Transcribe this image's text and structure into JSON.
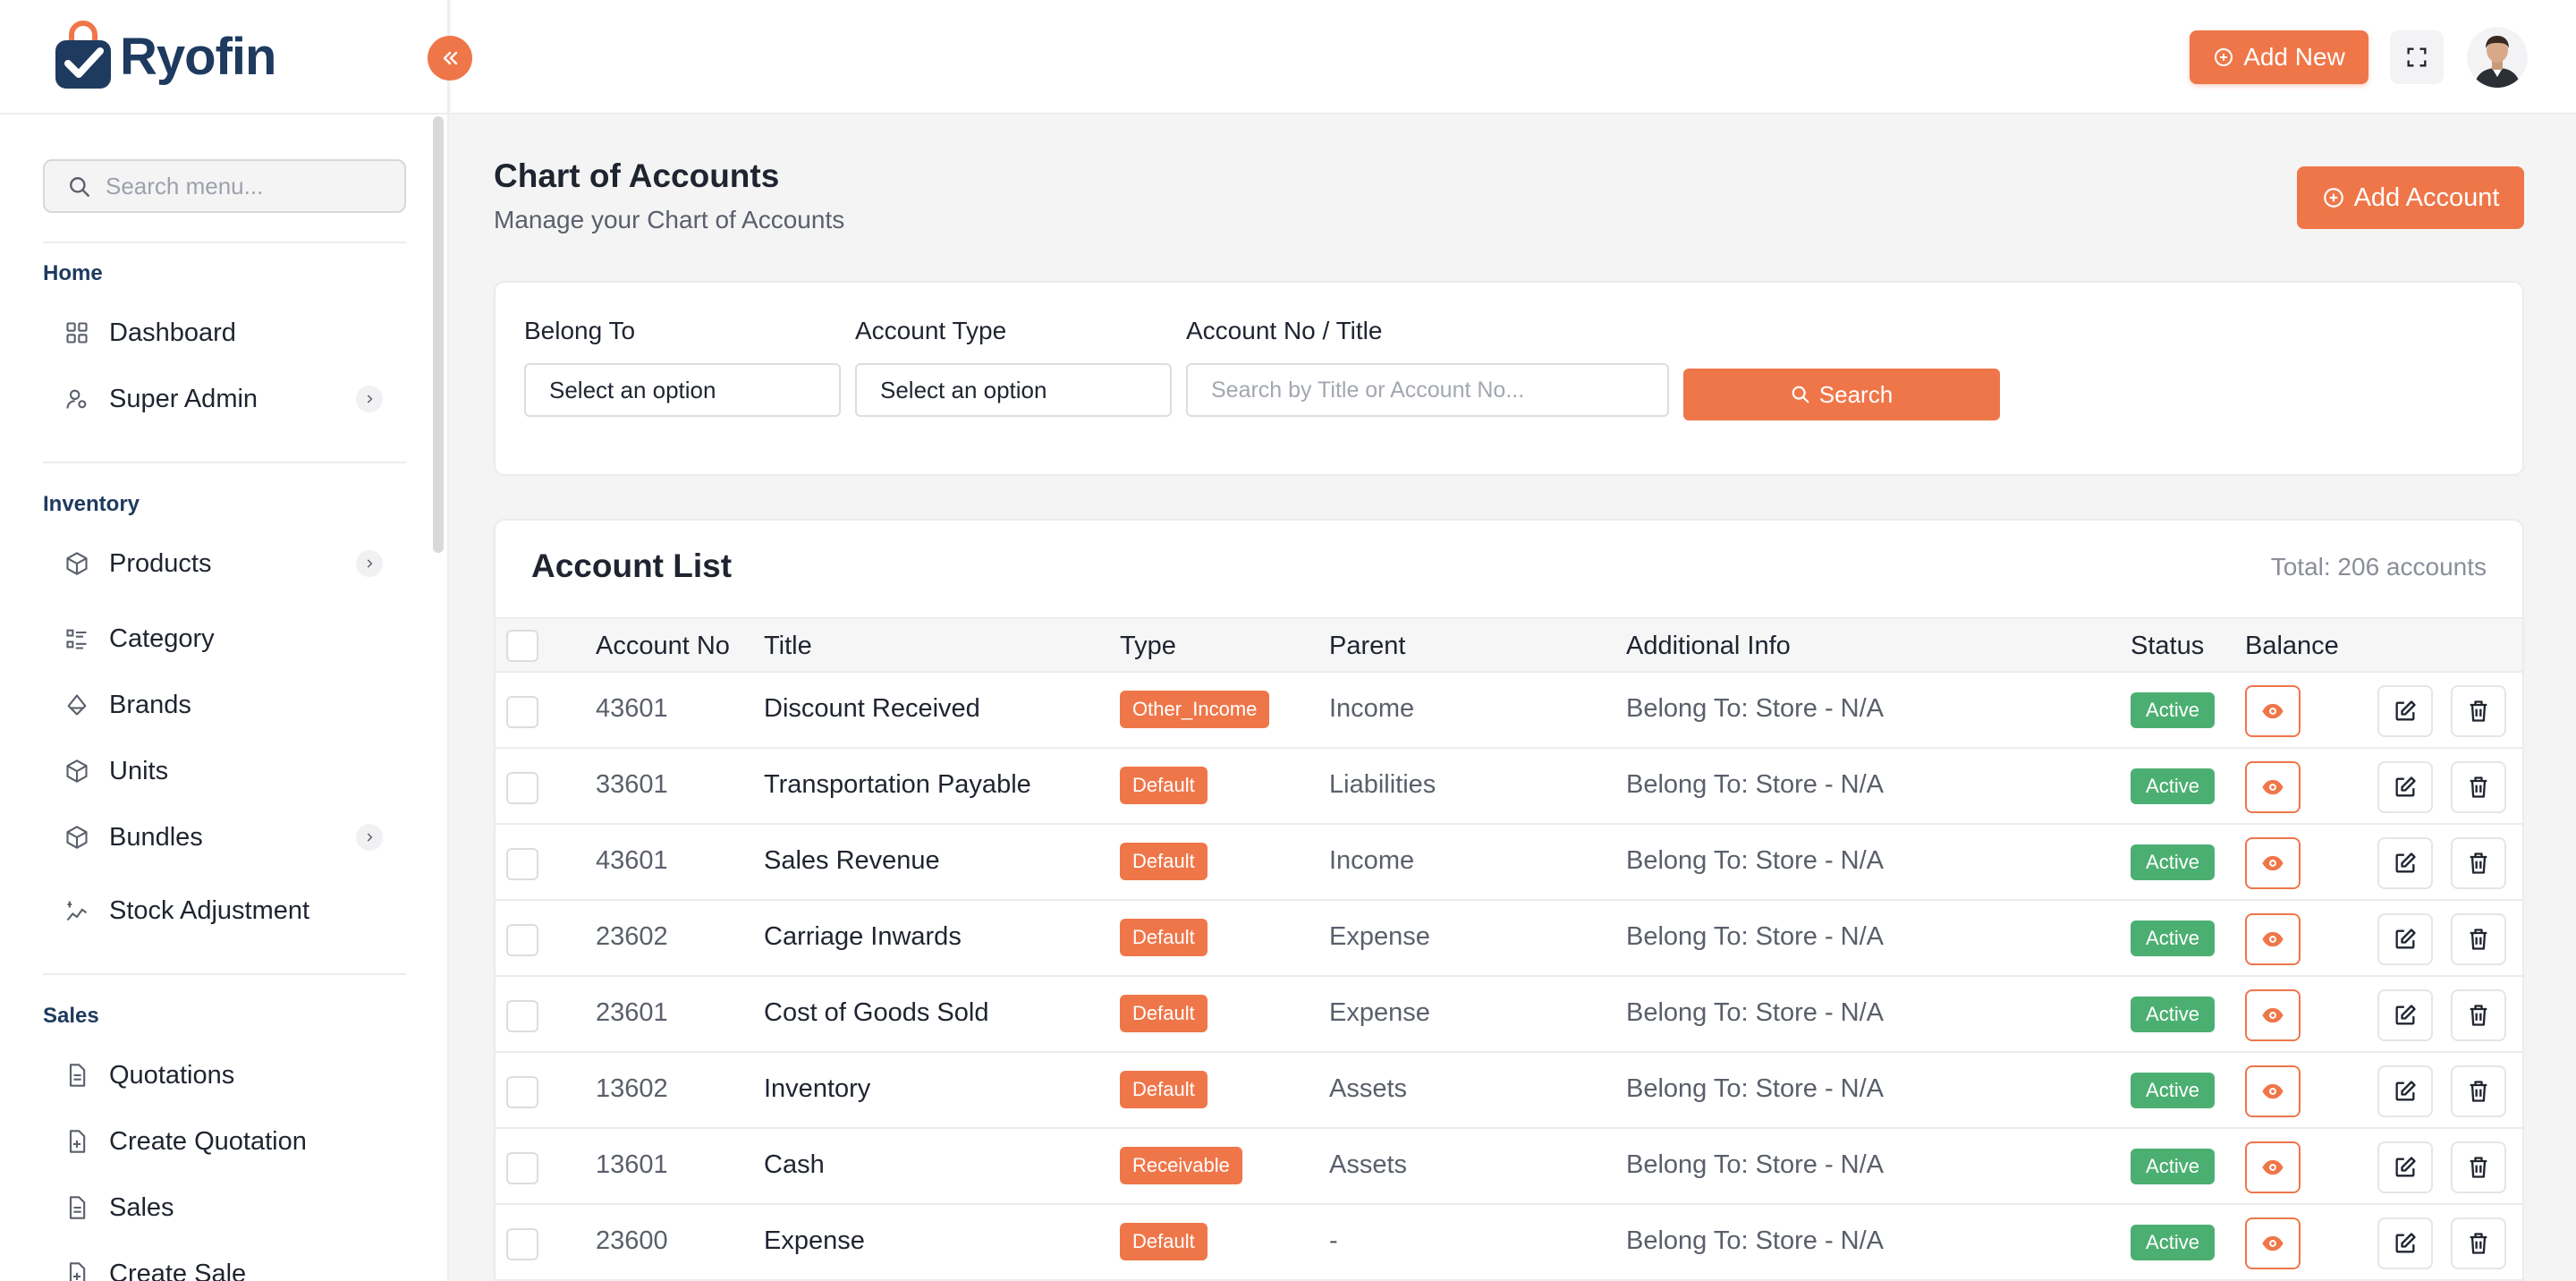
{
  "brand": {
    "name": "Ryofin"
  },
  "sidebar": {
    "search_placeholder": "Search menu...",
    "sections": [
      {
        "title": "Home"
      },
      {
        "title": "Inventory"
      },
      {
        "title": "Sales"
      }
    ],
    "items": [
      {
        "label": "Dashboard",
        "icon": "grid-icon"
      },
      {
        "label": "Super Admin",
        "icon": "user-cog-icon"
      },
      {
        "label": "Products",
        "icon": "box-icon"
      },
      {
        "label": "Category",
        "icon": "list-icon"
      },
      {
        "label": "Brands",
        "icon": "tag-icon"
      },
      {
        "label": "Units",
        "icon": "cube-icon"
      },
      {
        "label": "Bundles",
        "icon": "package-icon"
      },
      {
        "label": "Stock Adjustment",
        "icon": "adjust-icon"
      },
      {
        "label": "Quotations",
        "icon": "document-icon"
      },
      {
        "label": "Create Quotation",
        "icon": "document-plus-icon"
      },
      {
        "label": "Sales",
        "icon": "document-icon"
      },
      {
        "label": "Create Sale",
        "icon": "document-plus-icon"
      }
    ]
  },
  "header": {
    "add_new_label": "Add New"
  },
  "page": {
    "title": "Chart of Accounts",
    "subtitle": "Manage your Chart of Accounts",
    "add_account_label": "Add Account"
  },
  "filters": {
    "belong_to_label": "Belong To",
    "belong_to_value": "Select an option",
    "account_type_label": "Account Type",
    "account_type_value": "Select an option",
    "account_no_label": "Account No / Title",
    "account_no_placeholder": "Search by Title or Account No...",
    "search_label": "Search"
  },
  "list": {
    "title": "Account List",
    "total": "Total: 206 accounts",
    "columns": [
      "Account No",
      "Title",
      "Type",
      "Parent",
      "Additional Info",
      "Status",
      "Balance"
    ],
    "rows": [
      {
        "account_no": "43601",
        "title": "Discount Received",
        "type": "Other_Income",
        "parent": "Income",
        "info": "Belong To: Store - N/A",
        "status": "Active"
      },
      {
        "account_no": "33601",
        "title": "Transportation Payable",
        "type": "Default",
        "parent": "Liabilities",
        "info": "Belong To: Store - N/A",
        "status": "Active"
      },
      {
        "account_no": "43601",
        "title": "Sales Revenue",
        "type": "Default",
        "parent": "Income",
        "info": "Belong To: Store - N/A",
        "status": "Active"
      },
      {
        "account_no": "23602",
        "title": "Carriage Inwards",
        "type": "Default",
        "parent": "Expense",
        "info": "Belong To: Store - N/A",
        "status": "Active"
      },
      {
        "account_no": "23601",
        "title": "Cost of Goods Sold",
        "type": "Default",
        "parent": "Expense",
        "info": "Belong To: Store - N/A",
        "status": "Active"
      },
      {
        "account_no": "13602",
        "title": "Inventory",
        "type": "Default",
        "parent": "Assets",
        "info": "Belong To: Store - N/A",
        "status": "Active"
      },
      {
        "account_no": "13601",
        "title": "Cash",
        "type": "Receivable",
        "parent": "Assets",
        "info": "Belong To: Store - N/A",
        "status": "Active"
      },
      {
        "account_no": "23600",
        "title": "Expense",
        "type": "Default",
        "parent": "-",
        "info": "Belong To: Store - N/A",
        "status": "Active"
      }
    ]
  },
  "colors": {
    "accent": "#ef7649",
    "brand_navy": "#1e3a5f",
    "status_active": "#4caf72"
  }
}
